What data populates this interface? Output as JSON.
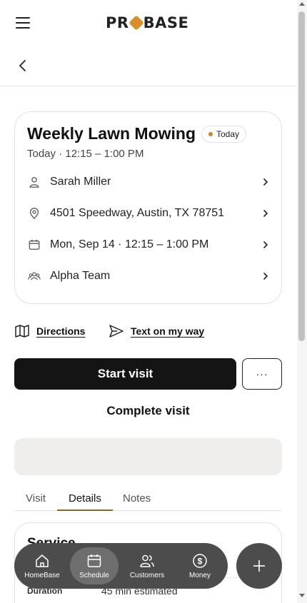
{
  "header": {
    "logo": "PROBASE"
  },
  "visit": {
    "title": "Weekly Lawn Mowing",
    "badge": "Today",
    "subtitle": "Today · 12:15 – 1:00 PM",
    "rows": [
      {
        "icon": "person-icon",
        "text": "Sarah Miller"
      },
      {
        "icon": "location-pin-icon",
        "text": "4501 Speedway, Austin, TX 78751"
      },
      {
        "icon": "calendar-icon",
        "text": "Mon, Sep 14 · 12:15 – 1:00 PM"
      },
      {
        "icon": "team-icon",
        "text": "Alpha Team"
      }
    ]
  },
  "actions": {
    "directions": "Directions",
    "on_my_way": "Text on my way"
  },
  "buttons": {
    "start": "Start visit",
    "more": "···",
    "complete": "Complete visit"
  },
  "tabs": [
    {
      "label": "Visit",
      "active": false
    },
    {
      "label": "Details",
      "active": true
    },
    {
      "label": "Notes",
      "active": false
    }
  ],
  "service": {
    "title": "Service",
    "duration_label": "Duration",
    "duration_value": "45 min estimated"
  },
  "nav": [
    {
      "label": "HomeBase",
      "icon": "home-icon",
      "active": false
    },
    {
      "label": "Schedule",
      "icon": "calendar-icon",
      "active": true
    },
    {
      "label": "Customers",
      "icon": "customers-icon",
      "active": false
    },
    {
      "label": "Money",
      "icon": "dollar-icon",
      "active": false
    }
  ],
  "colors": {
    "accent": "#c8862a",
    "primary_button": "#141414",
    "nav_bg": "#4c4c4c"
  }
}
